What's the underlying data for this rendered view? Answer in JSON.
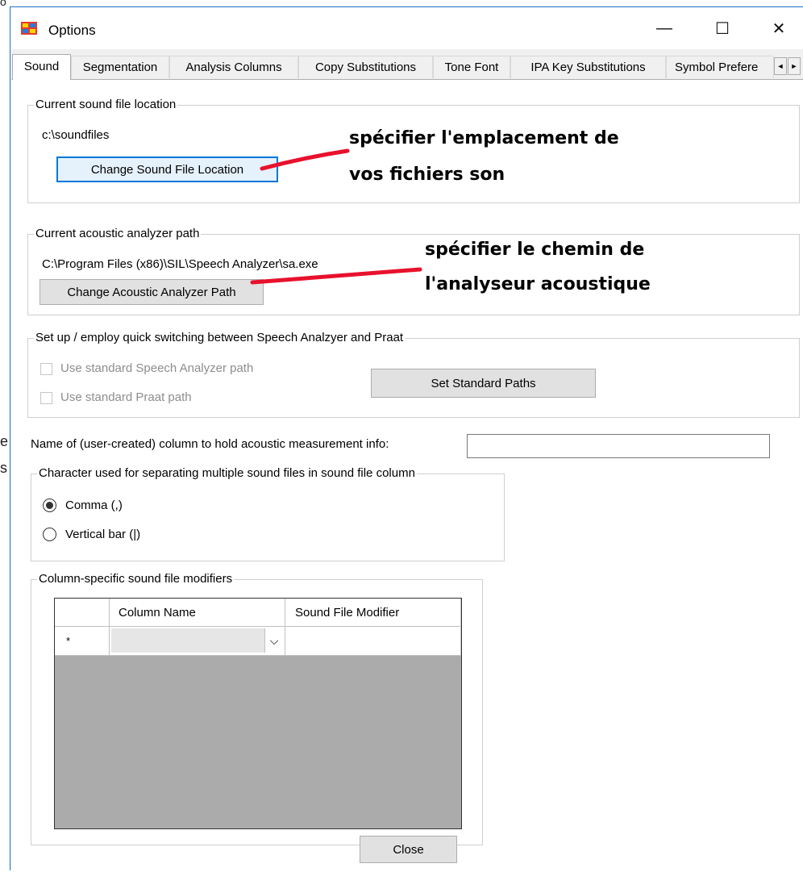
{
  "background": {
    "fragment_1": "e",
    "fragment_2": "s",
    "fragment_3": "o"
  },
  "window": {
    "title": "Options",
    "controls": {
      "minimize": "—",
      "maximize": "☐",
      "close": "✕"
    }
  },
  "tabs": [
    {
      "label": "Sound"
    },
    {
      "label": "Segmentation"
    },
    {
      "label": "Analysis Columns"
    },
    {
      "label": "Copy Substitutions"
    },
    {
      "label": "Tone Font"
    },
    {
      "label": "IPA Key Substitutions"
    },
    {
      "label": "Symbol Prefere"
    }
  ],
  "tab_scroll": {
    "left": "◄",
    "right": "►"
  },
  "sound_location": {
    "legend": "Current sound file location",
    "path": "c:\\soundfiles",
    "button": "Change Sound File Location",
    "annotation_line1": "spécifier l'emplacement de",
    "annotation_line2": "vos fichiers son"
  },
  "analyzer": {
    "legend": "Current acoustic analyzer path",
    "path": "C:\\Program Files (x86)\\SIL\\Speech Analyzer\\sa.exe",
    "button": "Change Acoustic Analyzer Path",
    "annotation_line1": "spécifier le chemin de",
    "annotation_line2": "l'analyseur acoustique"
  },
  "quick_switch": {
    "legend": "Set up / employ quick switching between Speech Analzyer and Praat",
    "check_sa": "Use standard Speech Analyzer path",
    "check_praat": "Use standard Praat path",
    "button": "Set Standard Paths"
  },
  "measurement": {
    "label": "Name of (user-created) column to hold acoustic measurement info:",
    "value": ""
  },
  "separator": {
    "legend": "Character used for separating multiple sound files in sound file column",
    "option_comma": "Comma (,)",
    "option_bar": "Vertical bar (|)",
    "selected": "comma"
  },
  "modifiers": {
    "legend": "Column-specific sound file modifiers",
    "columns": [
      "Column Name",
      "Sound File Modifier"
    ],
    "new_row_marker": "*",
    "dropdown_glyph": "⌵"
  },
  "close_button": "Close",
  "colors": {
    "accent": "#0078d7",
    "annotation_line": "#e8112d",
    "grid_bg": "#ababab"
  }
}
